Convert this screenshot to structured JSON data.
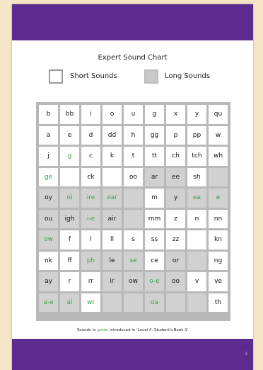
{
  "page": {
    "number": "1"
  },
  "chart": {
    "title": "Expert Sound Chart"
  },
  "legend": {
    "short": "Short Sounds",
    "long": "Long Sounds"
  },
  "grid": {
    "rows": [
      [
        {
          "t": "b",
          "k": "w"
        },
        {
          "t": "bb",
          "k": "w"
        },
        {
          "t": "i",
          "k": "w"
        },
        {
          "t": "o",
          "k": "w"
        },
        {
          "t": "u",
          "k": "w"
        },
        {
          "t": "g",
          "k": "w"
        },
        {
          "t": "x",
          "k": "w"
        },
        {
          "t": "y",
          "k": "w"
        },
        {
          "t": "qu",
          "k": "w"
        }
      ],
      [
        {
          "t": "a",
          "k": "w"
        },
        {
          "t": "e",
          "k": "w"
        },
        {
          "t": "d",
          "k": "w"
        },
        {
          "t": "dd",
          "k": "w"
        },
        {
          "t": "h",
          "k": "w"
        },
        {
          "t": "gg",
          "k": "w"
        },
        {
          "t": "p",
          "k": "w"
        },
        {
          "t": "pp",
          "k": "w"
        },
        {
          "t": "w",
          "k": "w"
        }
      ],
      [
        {
          "t": "j",
          "k": "w"
        },
        {
          "t": "g",
          "k": "w",
          "c": "green"
        },
        {
          "t": "c",
          "k": "w"
        },
        {
          "t": "k",
          "k": "w"
        },
        {
          "t": "t",
          "k": "w"
        },
        {
          "t": "tt",
          "k": "w"
        },
        {
          "t": "ch",
          "k": "w"
        },
        {
          "t": "tch",
          "k": "w"
        },
        {
          "t": "wh",
          "k": "w"
        }
      ],
      [
        {
          "t": "ge",
          "k": "w",
          "c": "green"
        },
        {
          "t": "",
          "k": "w"
        },
        {
          "t": "ck",
          "k": "w"
        },
        {
          "t": "",
          "k": "w"
        },
        {
          "t": "oo",
          "k": "w"
        },
        {
          "t": "ar",
          "k": "g"
        },
        {
          "t": "ee",
          "k": "g"
        },
        {
          "t": "sh",
          "k": "w"
        },
        {
          "t": "",
          "k": "g"
        }
      ],
      [
        {
          "t": "oy",
          "k": "g"
        },
        {
          "t": "oi",
          "k": "g",
          "c": "green"
        },
        {
          "t": "ire",
          "k": "g",
          "c": "green"
        },
        {
          "t": "ear",
          "k": "g",
          "c": "green"
        },
        {
          "t": "",
          "k": "g"
        },
        {
          "t": "m",
          "k": "w"
        },
        {
          "t": "y",
          "k": "g"
        },
        {
          "t": "ea",
          "k": "g",
          "c": "green"
        },
        {
          "t": "e",
          "k": "g",
          "c": "green"
        }
      ],
      [
        {
          "t": "ou",
          "k": "g"
        },
        {
          "t": "igh",
          "k": "g"
        },
        {
          "t": "i-e",
          "k": "g",
          "c": "green"
        },
        {
          "t": "air",
          "k": "g"
        },
        {
          "t": "",
          "k": "g"
        },
        {
          "t": "mm",
          "k": "w"
        },
        {
          "t": "z",
          "k": "w"
        },
        {
          "t": "n",
          "k": "w"
        },
        {
          "t": "nn",
          "k": "w"
        }
      ],
      [
        {
          "t": "ow",
          "k": "g",
          "c": "green"
        },
        {
          "t": "f",
          "k": "w"
        },
        {
          "t": "l",
          "k": "w"
        },
        {
          "t": "ll",
          "k": "w"
        },
        {
          "t": "s",
          "k": "w"
        },
        {
          "t": "ss",
          "k": "w"
        },
        {
          "t": "zz",
          "k": "w"
        },
        {
          "t": "",
          "k": "w"
        },
        {
          "t": "kn",
          "k": "w"
        }
      ],
      [
        {
          "t": "nk",
          "k": "w"
        },
        {
          "t": "ff",
          "k": "w"
        },
        {
          "t": "ph",
          "k": "g",
          "c": "green"
        },
        {
          "t": "le",
          "k": "g"
        },
        {
          "t": "se",
          "k": "g",
          "c": "green"
        },
        {
          "t": "ce",
          "k": "w"
        },
        {
          "t": "or",
          "k": "g"
        },
        {
          "t": "",
          "k": "g"
        },
        {
          "t": "ng",
          "k": "w"
        }
      ],
      [
        {
          "t": "ay",
          "k": "g"
        },
        {
          "t": "r",
          "k": "w"
        },
        {
          "t": "rr",
          "k": "w"
        },
        {
          "t": "ir",
          "k": "g"
        },
        {
          "t": "ow",
          "k": "g"
        },
        {
          "t": "o-e",
          "k": "g",
          "c": "green"
        },
        {
          "t": "oo",
          "k": "g"
        },
        {
          "t": "v",
          "k": "w"
        },
        {
          "t": "ve",
          "k": "w"
        }
      ],
      [
        {
          "t": "a-e",
          "k": "g",
          "c": "green"
        },
        {
          "t": "ai",
          "k": "g",
          "c": "green"
        },
        {
          "t": "wr",
          "k": "w",
          "c": "green"
        },
        {
          "t": "",
          "k": "g"
        },
        {
          "t": "",
          "k": "g"
        },
        {
          "t": "oa",
          "k": "g",
          "c": "green"
        },
        {
          "t": "",
          "k": "g"
        },
        {
          "t": "",
          "k": "g"
        },
        {
          "t": "th",
          "k": "w"
        }
      ]
    ]
  },
  "footnote": {
    "pre": "Sounds in ",
    "green": "green",
    "post": " introduced in 'Level 4: Student's Book 1'"
  },
  "colors": {
    "purple": "#5b2b8e",
    "green": "#3aa346",
    "grey": "#d1d1d1"
  }
}
